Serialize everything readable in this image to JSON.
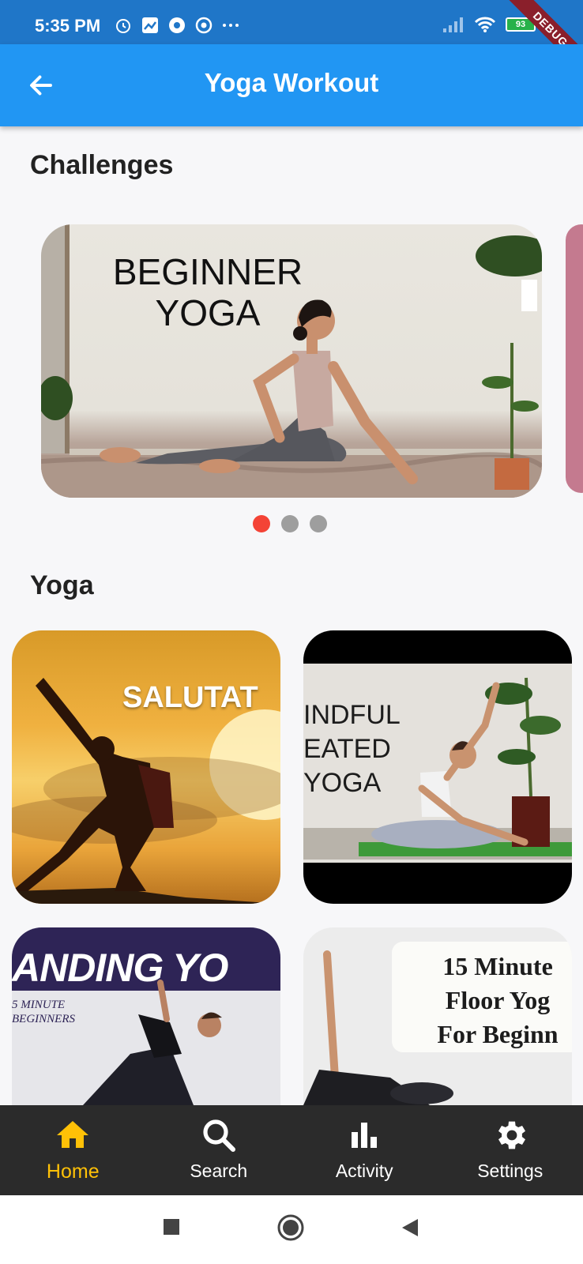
{
  "status_bar": {
    "time": "5:35 PM",
    "battery": "93",
    "debug_ribbon": "DEBUG"
  },
  "app_bar": {
    "title": "Yoga Workout"
  },
  "challenges": {
    "title": "Challenges",
    "card_text_line1": "BEGINNER",
    "card_text_line2": "YOGA",
    "dots": 3,
    "active_dot": 0
  },
  "yoga": {
    "title": "Yoga",
    "tiles": [
      {
        "text": "SALUTAT"
      },
      {
        "text_lines": [
          "INDFUL",
          "EATED",
          "YOGA"
        ]
      },
      {
        "text": "ANDING YO",
        "sub1": "5 MINUTE",
        "sub2": "BEGINNERS"
      },
      {
        "text_lines": [
          "15 Minute",
          "Floor Yog",
          "For Beginn"
        ]
      }
    ]
  },
  "bottom_nav": {
    "items": [
      {
        "label": "Home",
        "icon": "home-icon",
        "active": true
      },
      {
        "label": "Search",
        "icon": "search-icon",
        "active": false
      },
      {
        "label": "Activity",
        "icon": "bar-chart-icon",
        "active": false
      },
      {
        "label": "Settings",
        "icon": "gear-icon",
        "active": false
      }
    ]
  },
  "colors": {
    "app_bar": "#2196f3",
    "status_bar": "#1f76c8",
    "active_nav": "#ffc107",
    "dot_active": "#f44336",
    "nav_bg": "#2b2b2b"
  }
}
